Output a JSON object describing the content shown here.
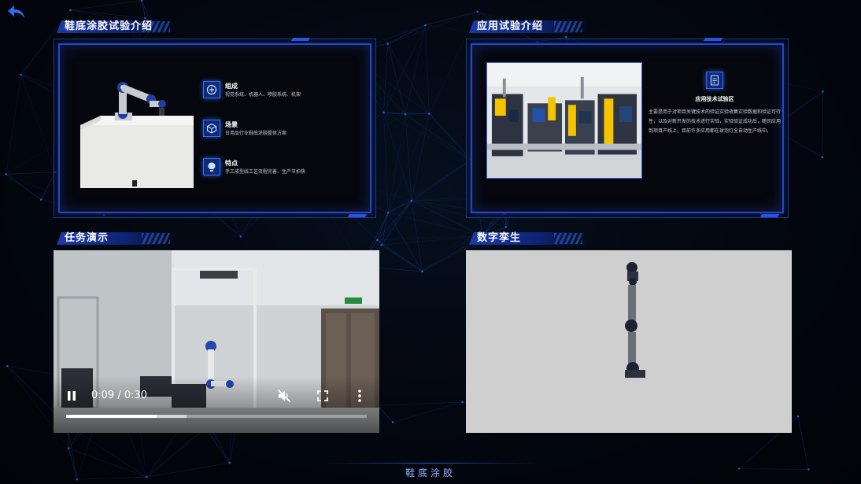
{
  "nav": {
    "back_icon": "back-arrow-icon"
  },
  "panels": {
    "shoe_intro": {
      "title": "鞋底涂胶试验介绍",
      "features": [
        {
          "icon": "plus-circle-icon",
          "title": "组成",
          "desc": "视觉系统、机器人、喷胶系统、机架"
        },
        {
          "icon": "cube-icon",
          "title": "场景",
          "desc": "日用品行业鞋底涂胶整体方案"
        },
        {
          "icon": "lightbulb-icon",
          "title": "特点",
          "desc": "手工成型线工艺流程完善、生产节拍快"
        }
      ]
    },
    "app_intro": {
      "title": "应用试验介绍",
      "icon": "document-icon",
      "block_title": "应用技术试验区",
      "block_desc": "主要是用于对项目关键技术的验证实验收集实验数据和验证可行性，以及对新开发的技术进行实验，实验验证成功后，随司应用到项目产线上，目前许多应用都在球泡灯全自动生产线中。"
    },
    "task_demo": {
      "title": "任务演示",
      "video": {
        "current_time": "0:09",
        "duration": "0:30",
        "separator": " / ",
        "played_fraction": 0.3,
        "buffered_fraction": 0.4
      }
    },
    "digital_twin": {
      "title": "数字孪生"
    }
  },
  "footer": {
    "title": "鞋底涂胶"
  },
  "colors": {
    "accent": "#2448c8",
    "title_bar": "#1b3aa8",
    "text_muted": "#c8cfe0"
  }
}
